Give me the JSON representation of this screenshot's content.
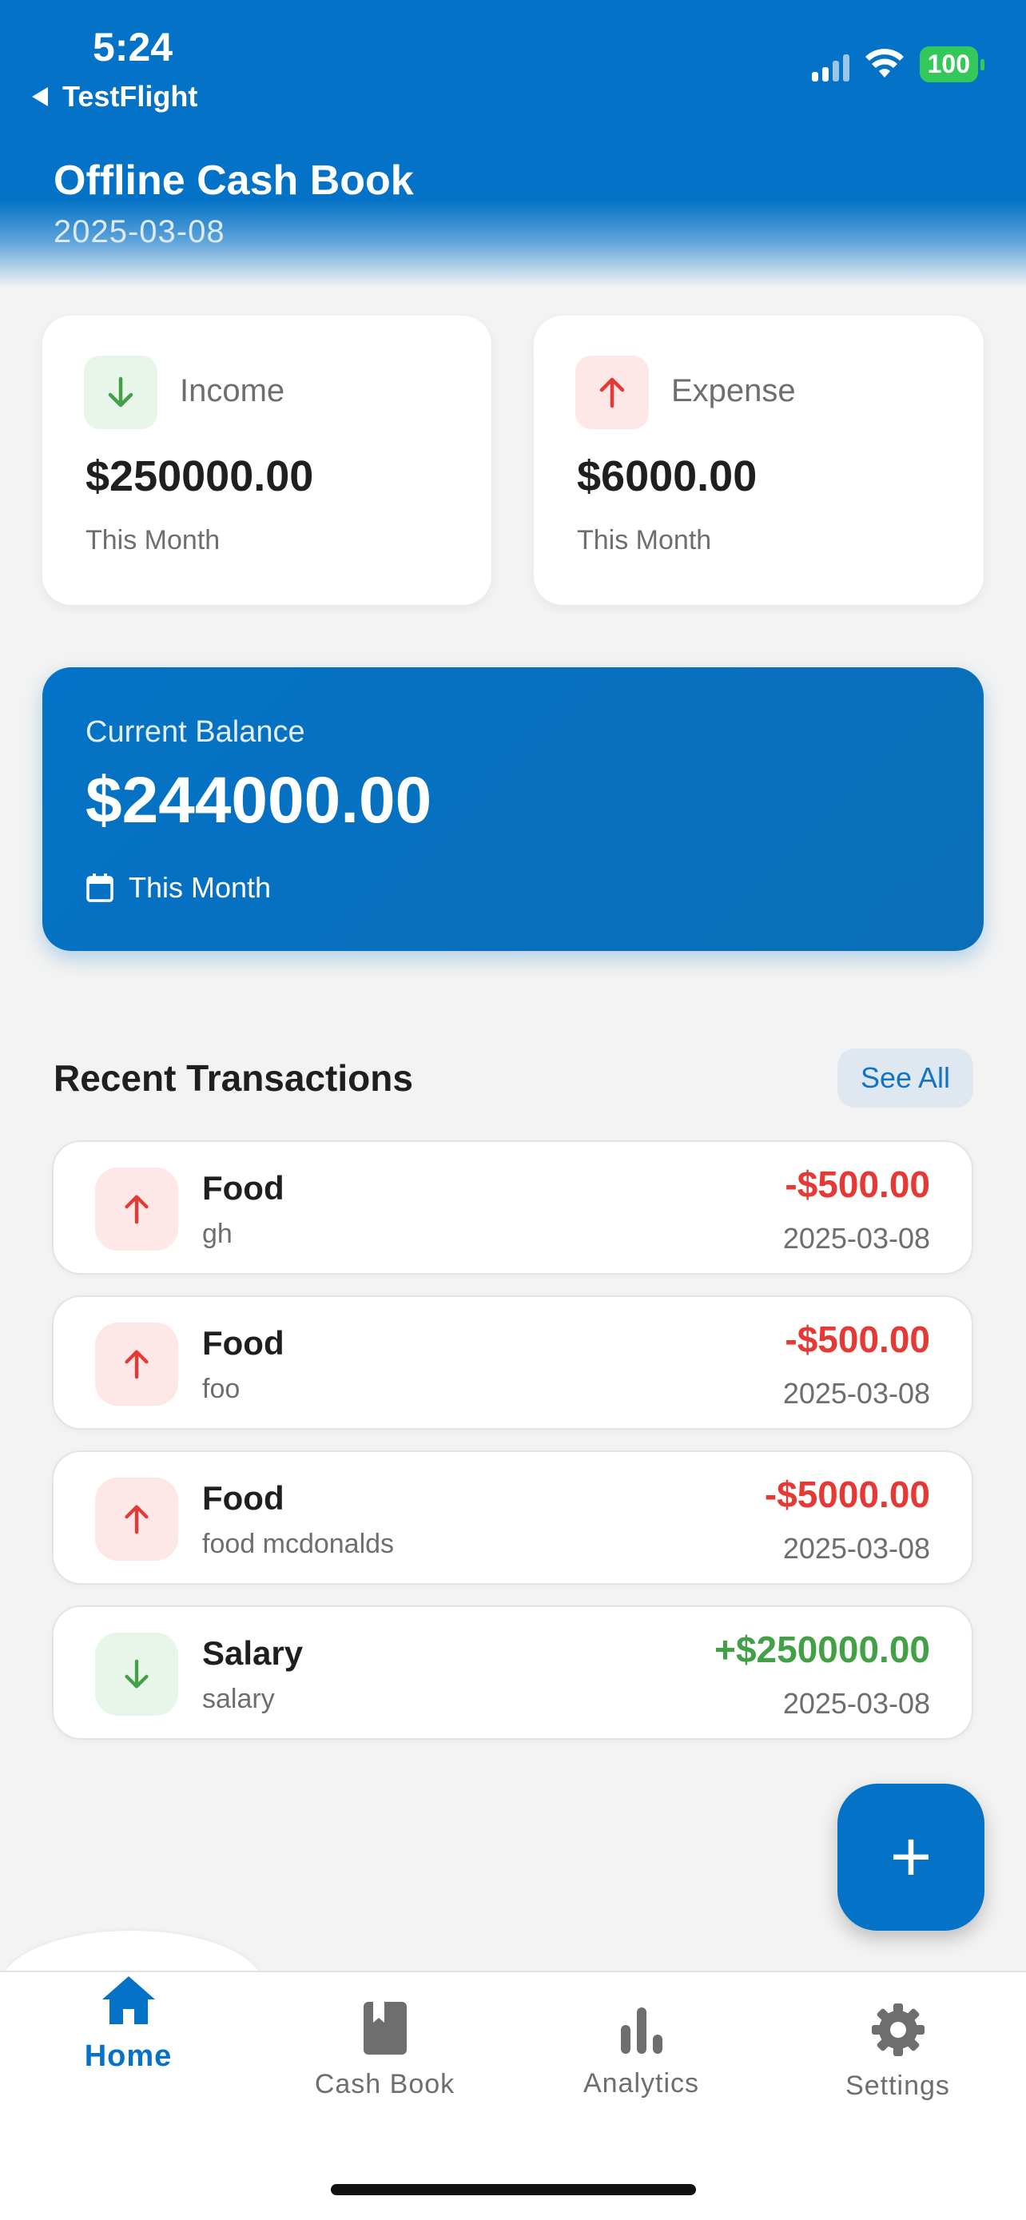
{
  "status_bar": {
    "time": "5:24",
    "back_label": "TestFlight",
    "battery": "100"
  },
  "header": {
    "title": "Offline Cash Book",
    "date": "2025-03-08"
  },
  "summary": {
    "income": {
      "label": "Income",
      "amount": "$250000.00",
      "period": "This Month"
    },
    "expense": {
      "label": "Expense",
      "amount": "$6000.00",
      "period": "This Month"
    }
  },
  "balance": {
    "label": "Current Balance",
    "amount": "$244000.00",
    "period": "This Month"
  },
  "recent": {
    "title": "Recent Transactions",
    "see_all": "See All",
    "items": [
      {
        "title": "Food",
        "note": "gh",
        "amount": "-$500.00",
        "date": "2025-03-08",
        "type": "expense"
      },
      {
        "title": "Food",
        "note": "foo",
        "amount": "-$500.00",
        "date": "2025-03-08",
        "type": "expense"
      },
      {
        "title": "Food",
        "note": "food mcdonalds",
        "amount": "-$5000.00",
        "date": "2025-03-08",
        "type": "expense"
      },
      {
        "title": "Salary",
        "note": "salary",
        "amount": "+$250000.00",
        "date": "2025-03-08",
        "type": "income"
      }
    ]
  },
  "fab": {
    "icon": "plus-icon",
    "label": "+"
  },
  "nav": {
    "items": [
      {
        "label": "Home",
        "icon": "home-icon",
        "active": true
      },
      {
        "label": "Cash Book",
        "icon": "book-icon",
        "active": false
      },
      {
        "label": "Analytics",
        "icon": "bar-chart-icon",
        "active": false
      },
      {
        "label": "Settings",
        "icon": "gear-icon",
        "active": false
      }
    ]
  },
  "colors": {
    "primary": "#0472c6",
    "income": "#43a047",
    "income_bg": "#e8f5e9",
    "expense": "#e53935",
    "expense_bg": "#fde8e7"
  }
}
